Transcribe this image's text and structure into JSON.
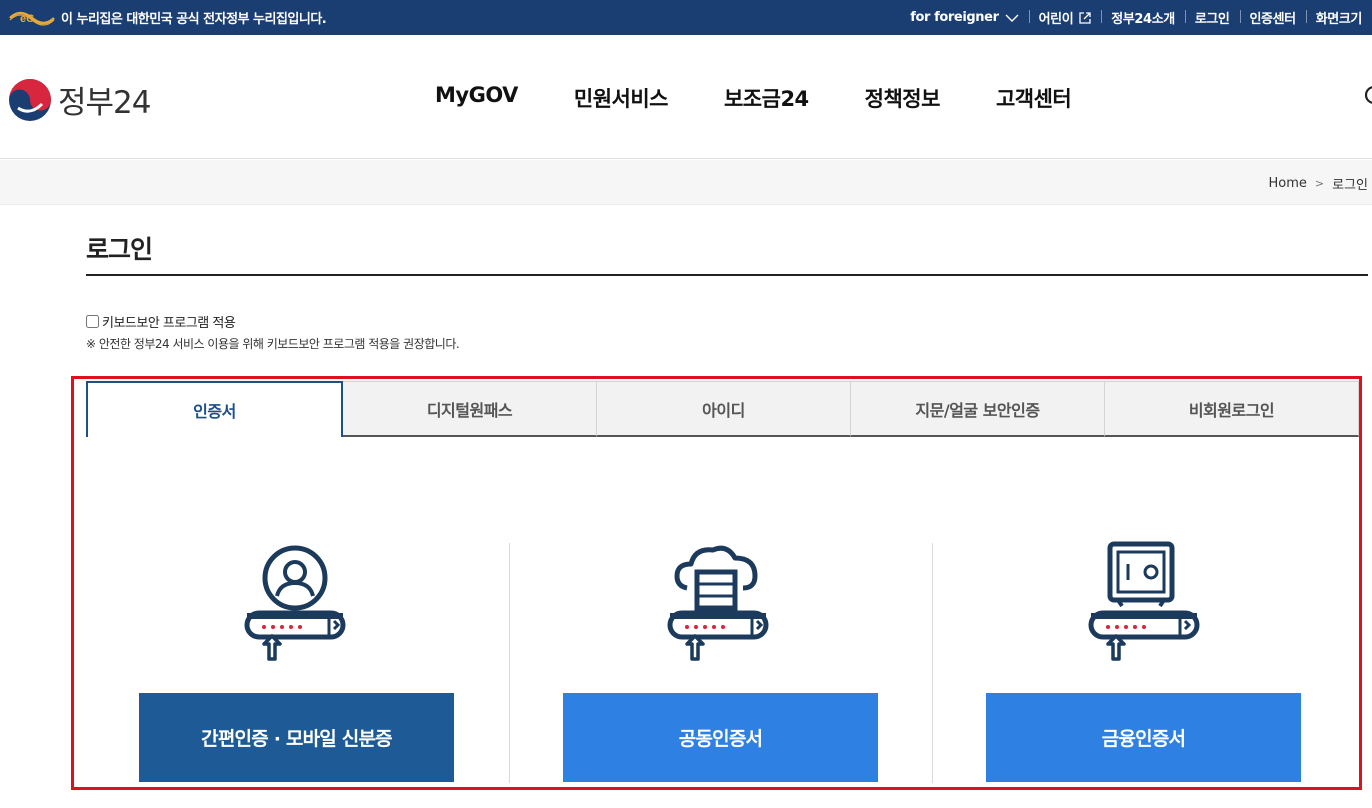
{
  "topbar": {
    "official_text": "이 누리집은 대한민국 공식 전자정부 누리집입니다.",
    "foreigner": "for foreigner",
    "kids": "어린이",
    "about": "정부24소개",
    "login": "로그인",
    "cert_center": "인증센터",
    "screen_size": "화면크기"
  },
  "header": {
    "logo_text": "정부24",
    "menu": [
      "MyGOV",
      "민원서비스",
      "보조금24",
      "정책정보",
      "고객센터"
    ]
  },
  "breadcrumb": {
    "home": "Home",
    "current": "로그인"
  },
  "page": {
    "title": "로그인",
    "keyboard_security_label": "키보드보안 프로그램 적용",
    "keyboard_security_checked": false,
    "keyboard_note": "※ 안전한 정부24 서비스 이용을 위해 키보드보안 프로그램 적용을 권장합니다."
  },
  "tabs": [
    {
      "label": "인증서",
      "active": true
    },
    {
      "label": "디지털원패스",
      "active": false
    },
    {
      "label": "아이디",
      "active": false
    },
    {
      "label": "지문/얼굴 보안인증",
      "active": false
    },
    {
      "label": "비회원로그인",
      "active": false
    }
  ],
  "cert_options": [
    {
      "label": "간편인증 · 모바일 신분증",
      "icon": "person-icon"
    },
    {
      "label": "공동인증서",
      "icon": "cloud-server-icon"
    },
    {
      "label": "금융인증서",
      "icon": "safe-icon"
    }
  ],
  "colors": {
    "topbar_bg": "#1a3d72",
    "highlight_border": "#e0101c",
    "icon_navy": "#1b3a5c",
    "icon_accent": "#e0213a",
    "button_primary": "#1e5a95",
    "button_light": "#2f80e3"
  }
}
